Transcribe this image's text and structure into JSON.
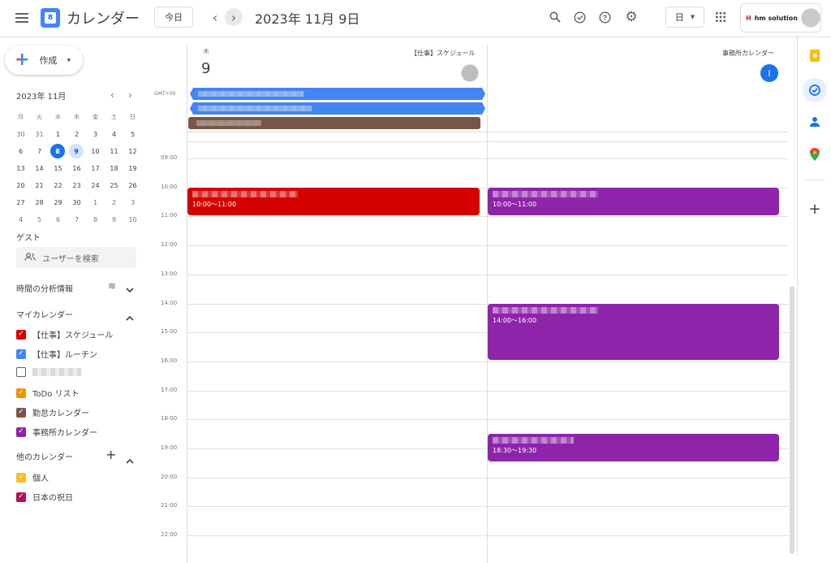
{
  "header": {
    "app_title": "カレンダー",
    "logo_day": "8",
    "today_label": "今日",
    "date_title": "2023年 11月 9日",
    "view_label": "日",
    "account_name": "hm solution"
  },
  "sidebar": {
    "create_label": "作成",
    "mini_month": "2023年 11月",
    "weekdays": [
      "月",
      "火",
      "水",
      "木",
      "金",
      "土",
      "日"
    ],
    "weeks": [
      [
        "30",
        "31",
        "1",
        "2",
        "3",
        "4",
        "5"
      ],
      [
        "6",
        "7",
        "8",
        "9",
        "10",
        "11",
        "12"
      ],
      [
        "13",
        "14",
        "15",
        "16",
        "17",
        "18",
        "19"
      ],
      [
        "20",
        "21",
        "22",
        "23",
        "24",
        "25",
        "26"
      ],
      [
        "27",
        "28",
        "29",
        "30",
        "1",
        "2",
        "3"
      ],
      [
        "4",
        "5",
        "6",
        "7",
        "8",
        "9",
        "10"
      ]
    ],
    "guest_label": "ゲスト",
    "search_user_placeholder": "ユーザーを検索",
    "analytics_label": "時間の分析情報",
    "my_calendars_label": "マイカレンダー",
    "my_calendars": [
      {
        "label": "【仕事】スケジュール",
        "color": "#d50000",
        "checked": true
      },
      {
        "label": "【仕事】ルーチン",
        "color": "#4285f4",
        "checked": true
      },
      {
        "label": "",
        "color": "#9e9e9e",
        "checked": false
      },
      {
        "label": "ToDo リスト",
        "color": "#f09300",
        "checked": true
      },
      {
        "label": "勤怠カレンダー",
        "color": "#795548",
        "checked": true
      },
      {
        "label": "事務所カレンダー",
        "color": "#8e24aa",
        "checked": true
      }
    ],
    "other_calendars_label": "他のカレンダー",
    "other_calendars": [
      {
        "label": "個人",
        "color": "#f6bf26",
        "checked": true
      },
      {
        "label": "日本の祝日",
        "color": "#ad1457",
        "checked": true
      }
    ]
  },
  "main": {
    "day_abbr": "木",
    "day_number": "9",
    "resource_1": "【仕事】スケジュール",
    "resource_2": "事務所カレンダー",
    "resource_2_initial": "I",
    "timezone": "GMT+09",
    "hours": [
      "09:00",
      "10:00",
      "11:00",
      "12:00",
      "13:00",
      "14:00",
      "15:00",
      "16:00",
      "17:00",
      "18:00",
      "19:00",
      "20:00",
      "21:00",
      "22:00"
    ],
    "events": [
      {
        "time": "10:00～11:00",
        "color": "#d50000"
      },
      {
        "time": "10:00～11:00",
        "color": "#8e24aa"
      },
      {
        "time": "14:00～16:00",
        "color": "#8e24aa"
      },
      {
        "time": "18:30～19:30",
        "color": "#8e24aa"
      }
    ],
    "allday_colors": [
      "#4285f4",
      "#4285f4",
      "#795548"
    ]
  }
}
